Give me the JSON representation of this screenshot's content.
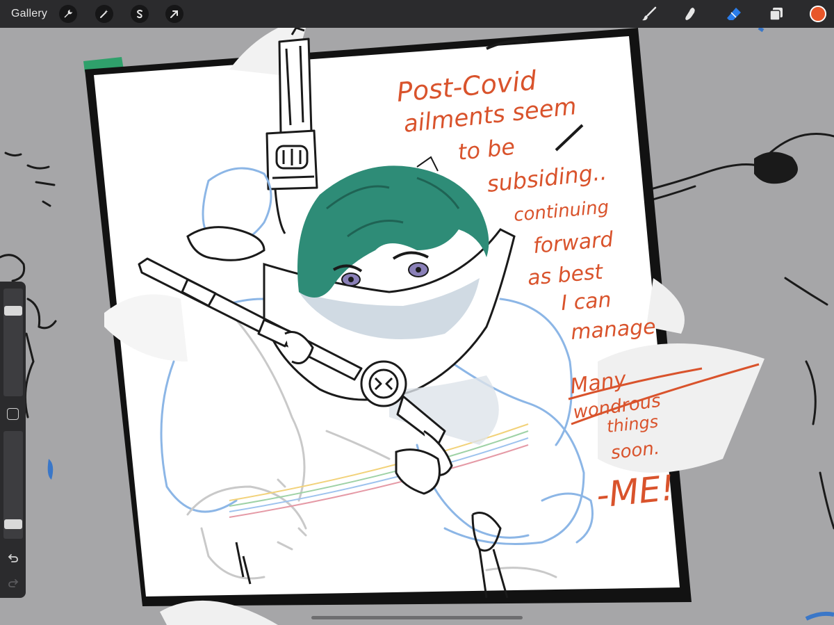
{
  "app": {
    "gallery_label": "Gallery"
  },
  "toolbar": {
    "left_tools": [
      "wrench-icon",
      "magic-wand-icon",
      "selection-icon",
      "transform-arrow-icon"
    ],
    "right_tools": [
      "brush-icon",
      "smudge-icon",
      "eraser-icon",
      "layers-icon"
    ],
    "active_tool": "eraser-icon",
    "active_color": "#e8572a",
    "active_tool_color": "#2b7de9"
  },
  "sidebar": {
    "size_level": 0.82,
    "opacity_level": 0.1
  },
  "artwork": {
    "note_lines": [
      "Post-Covid",
      "ailments seem",
      "to be",
      "subsiding..",
      "continuing",
      "forward",
      "as best",
      "I can",
      "manage",
      "Many",
      "wondrous",
      "things",
      "soon.",
      "-ME!"
    ],
    "ink_color": "#1a1a1a",
    "note_color": "#d9532c",
    "hair_color": "#2e8c77",
    "sketch_color": "#8cb6e6",
    "eye_color": "#8a80b8"
  }
}
